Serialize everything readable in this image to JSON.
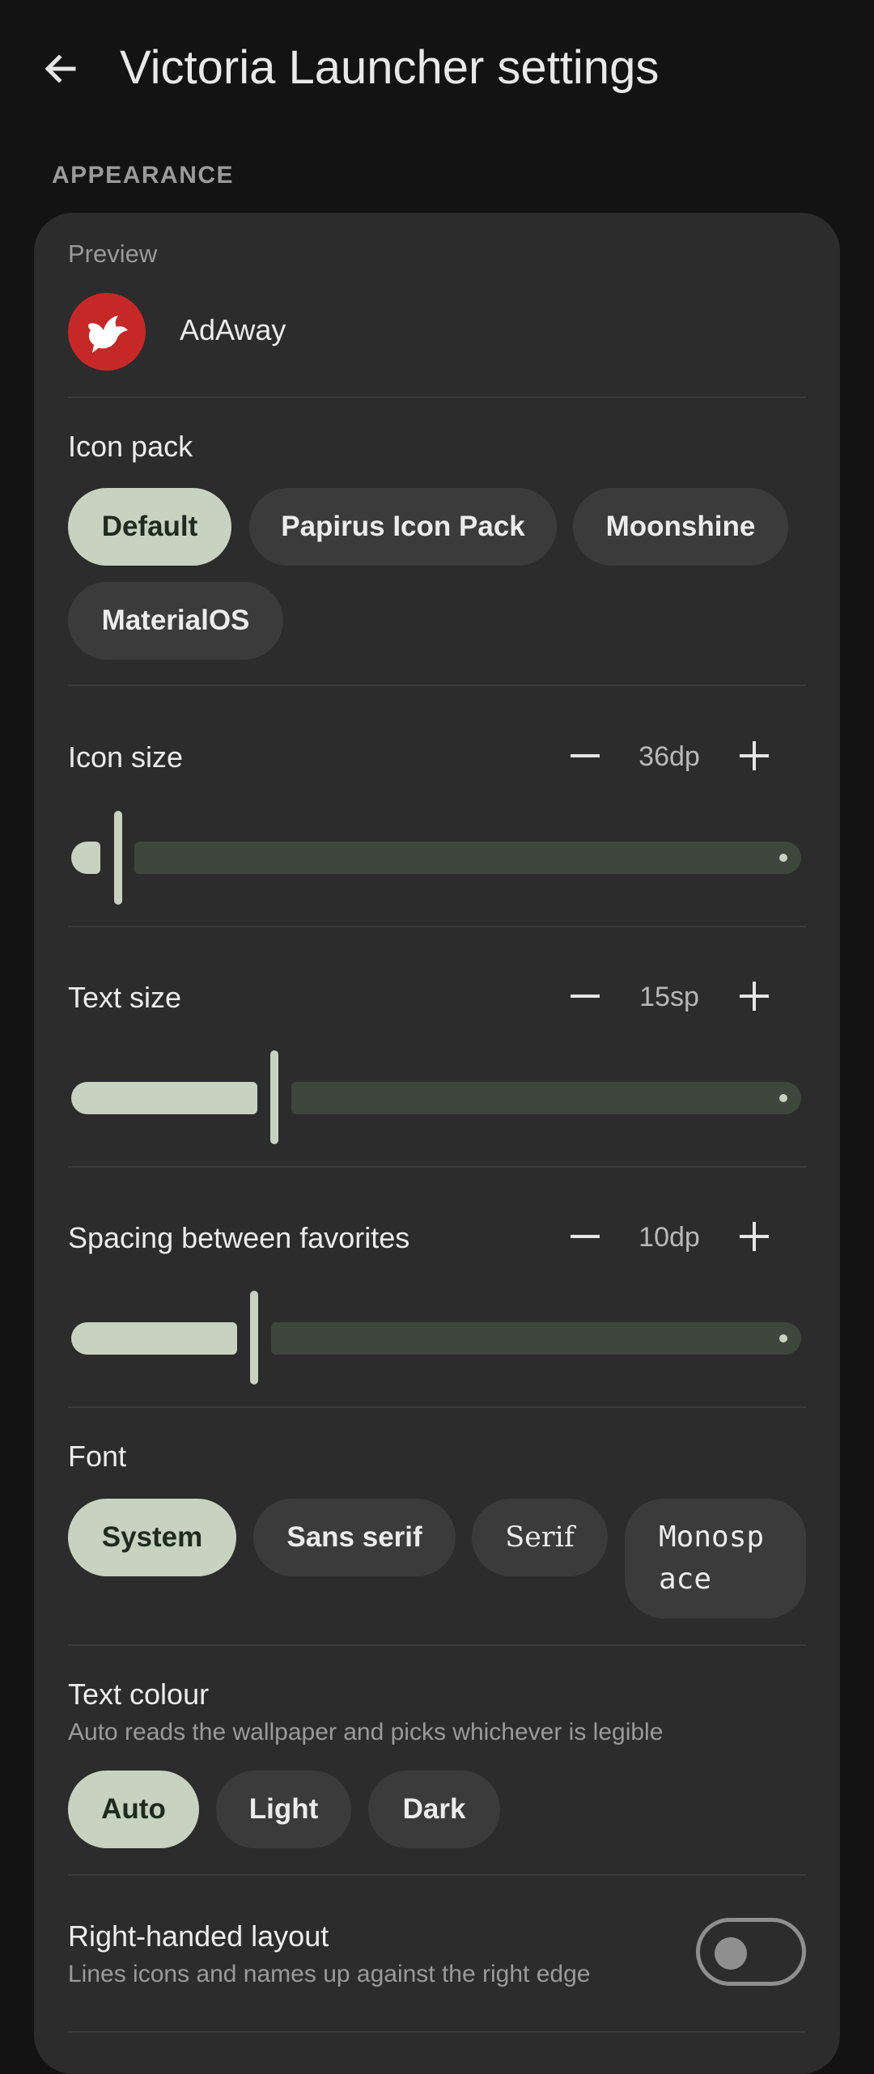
{
  "appbar": {
    "title": "Victoria Launcher settings"
  },
  "section": {
    "header": "APPEARANCE"
  },
  "preview": {
    "label": "Preview",
    "app_name": "AdAway"
  },
  "icon_pack": {
    "label": "Icon pack",
    "options": [
      "Default",
      "Papirus Icon Pack",
      "Moonshine",
      "MaterialOS"
    ],
    "selected": "Default"
  },
  "icon_size": {
    "label": "Icon size",
    "value": "36dp",
    "fraction": 0.0
  },
  "text_size": {
    "label": "Text size",
    "value": "15sp",
    "fraction": 0.27
  },
  "spacing": {
    "label": "Spacing between favorites",
    "value": "10dp",
    "fraction": 0.24
  },
  "font": {
    "label": "Font",
    "options": [
      "System",
      "Sans serif",
      "Serif",
      "Monosp",
      "ace"
    ],
    "selected": "System"
  },
  "text_colour": {
    "label": "Text colour",
    "description": "Auto reads the wallpaper and picks whichever is legible",
    "options": [
      "Auto",
      "Light",
      "Dark"
    ],
    "selected": "Auto"
  },
  "right_handed": {
    "label": "Right-handed layout",
    "description": "Lines icons and names up against the right edge",
    "enabled": false
  },
  "colors": {
    "accent": "#c7d3c0",
    "card": "#2c2c2c",
    "background": "#131313"
  }
}
